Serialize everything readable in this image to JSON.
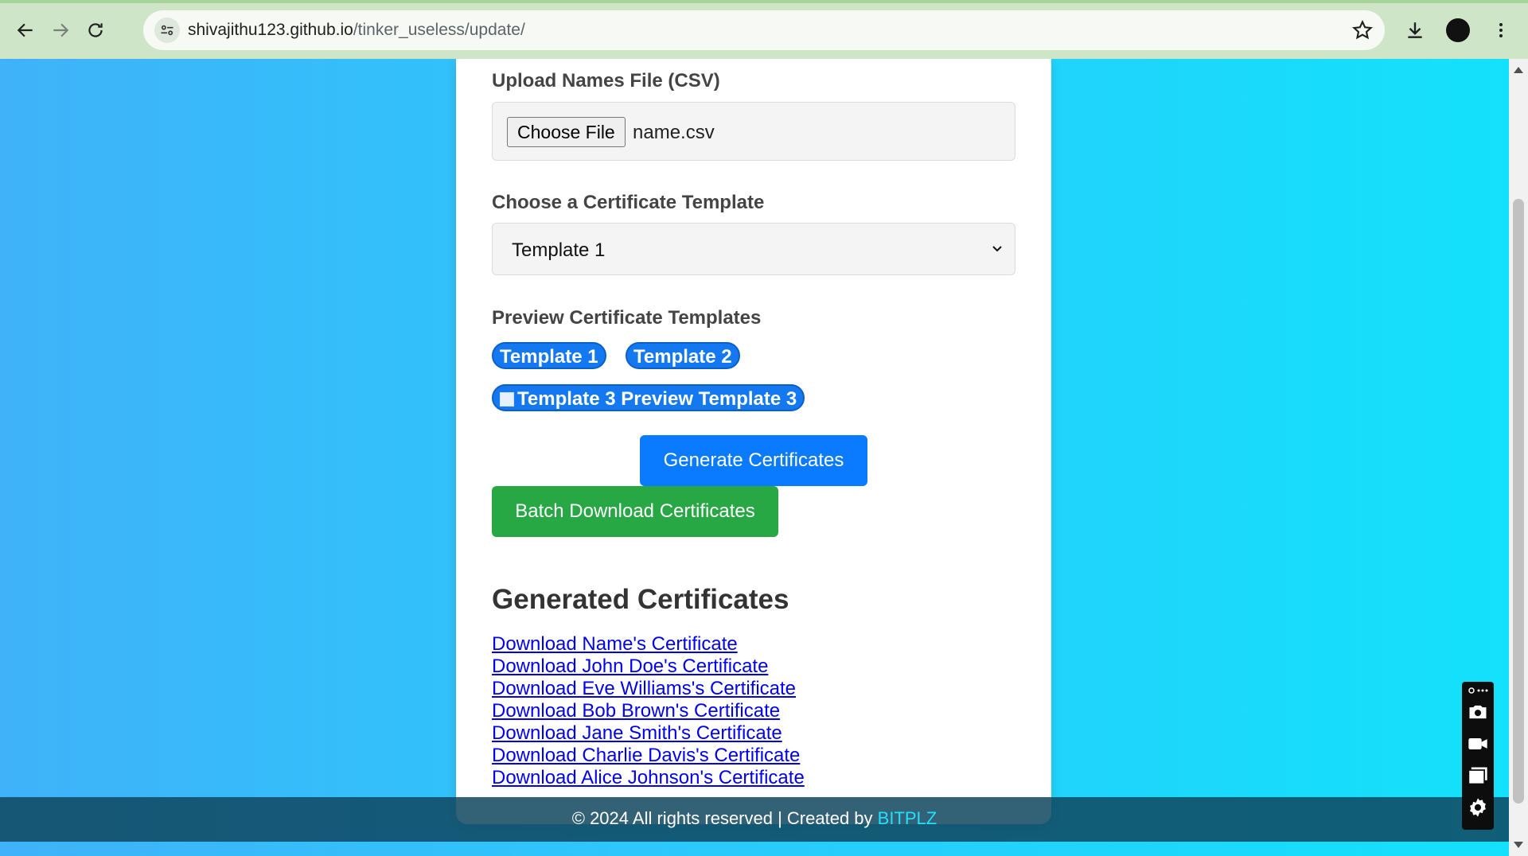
{
  "browser": {
    "url_host": "shivajithu123.github.io",
    "url_path": "/tinker_useless/update/"
  },
  "form": {
    "upload_label": "Upload Names File (CSV)",
    "file_button": "Choose File",
    "file_name": "name.csv",
    "template_label": "Choose a Certificate Template",
    "template_selected": "Template 1",
    "preview_label": "Preview Certificate Templates",
    "preview_pills": [
      "Template 1",
      "Template 2",
      "Template 3 Preview Template 3"
    ],
    "generate_button": "Generate Certificates",
    "batch_button": "Batch Download Certificates"
  },
  "generated": {
    "heading": "Generated Certificates",
    "links": [
      "Download Name's Certificate",
      "Download John Doe's Certificate",
      "Download Eve Williams's Certificate",
      "Download Bob Brown's Certificate",
      "Download Jane Smith's Certificate",
      "Download Charlie Davis's Certificate",
      "Download Alice Johnson's Certificate"
    ]
  },
  "footer": {
    "text": "© 2024 All rights reserved | Created by ",
    "brand": "BITPLZ"
  },
  "colors": {
    "primary": "#0a7bff",
    "success": "#28a745",
    "pill": "#1479f0",
    "link": "#0000ee",
    "brand": "#1ee0ff"
  }
}
